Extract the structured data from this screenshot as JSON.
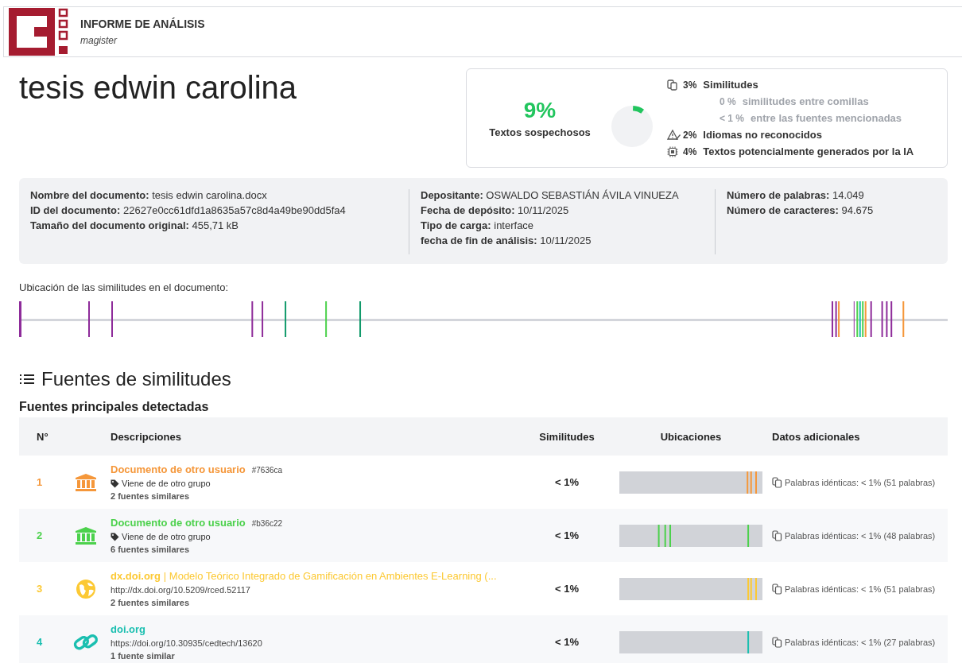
{
  "header": {
    "title": "INFORME DE ANÁLISIS",
    "subtitle": "magister"
  },
  "document_title": "tesis edwin carolina",
  "summary": {
    "score": "9%",
    "score_label": "Textos sospechosos",
    "items": [
      {
        "kind": "similarity",
        "value": "3%",
        "label": "Similitudes",
        "sub": false
      },
      {
        "kind": "none",
        "value": "0 %",
        "label": "similitudes entre comillas",
        "sub": true
      },
      {
        "kind": "none",
        "value": "< 1 %",
        "label": "entre las fuentes mencionadas",
        "sub": true
      },
      {
        "kind": "language",
        "value": "2%",
        "label": "Idiomas no reconocidos",
        "sub": false
      },
      {
        "kind": "ai",
        "value": "4%",
        "label": "Textos potencialmente generados por la IA",
        "sub": false
      }
    ]
  },
  "info": [
    [
      {
        "label": "Nombre del documento:",
        "value": "tesis edwin carolina.docx"
      },
      {
        "label": "ID del documento:",
        "value": "22627e0cc61dfd1a8635a57c8d4a49be90dd5fa4"
      },
      {
        "label": "Tamaño del documento original:",
        "value": "455,71 kB"
      }
    ],
    [
      {
        "label": "Depositante:",
        "value": "OSWALDO SEBASTIÁN ÁVILA VINUEZA"
      },
      {
        "label": "Fecha de depósito:",
        "value": "10/11/2025"
      },
      {
        "label": "Tipo de carga:",
        "value": "interface"
      },
      {
        "label": "fecha de fin de análisis:",
        "value": "10/11/2025"
      }
    ],
    [
      {
        "label": "Número de palabras:",
        "value": "14.049"
      },
      {
        "label": "Número de caracteres:",
        "value": "94.675"
      }
    ]
  ],
  "locations_label": "Ubicación de las similitudes en el documento:",
  "sources_heading": "Fuentes de similitudes",
  "sources_subheading": "Fuentes principales detectadas",
  "table": {
    "columns": [
      "N°",
      "Descripciones",
      "Similitudes",
      "Ubicaciones",
      "Datos adicionales"
    ],
    "rows": [
      {
        "number": "1",
        "kind": "institution",
        "color": "#f5973a",
        "title": "Documento de otro usuario",
        "hash": "#7636ca",
        "subline": {
          "kind": "tag",
          "text": "Viene de de otro grupo"
        },
        "count": "2 fuentes similares",
        "similarity": "< 1%",
        "data": "Palabras idénticas: < 1% (51 palabras)"
      },
      {
        "number": "2",
        "kind": "institution",
        "color": "#4cd14c",
        "title": "Documento de otro usuario",
        "hash": "#b36c22",
        "subline": {
          "kind": "tag",
          "text": "Viene de de otro grupo"
        },
        "count": "6 fuentes similares",
        "similarity": "< 1%",
        "data": "Palabras idénticas: < 1% (48 palabras)"
      },
      {
        "number": "3",
        "kind": "web",
        "color": "#fcc934",
        "title": "dx.doi.org",
        "title_extra": "| Modelo Teórico Integrado de Gamificación en Ambientes E-Learning (...",
        "subline": {
          "kind": "url",
          "text": "http://dx.doi.org/10.5209/rced.52117"
        },
        "count": "2 fuentes similares",
        "similarity": "< 1%",
        "data": "Palabras idénticas: < 1% (51 palabras)"
      },
      {
        "number": "4",
        "kind": "link",
        "color": "#1bbfb0",
        "title": "doi.org",
        "subline": {
          "kind": "url",
          "text": "https://doi.org/10.30935/cedtech/13620"
        },
        "count": "1 fuente similar",
        "similarity": "< 1%",
        "data": "Palabras idénticas: < 1% (27 palabras)"
      }
    ]
  }
}
